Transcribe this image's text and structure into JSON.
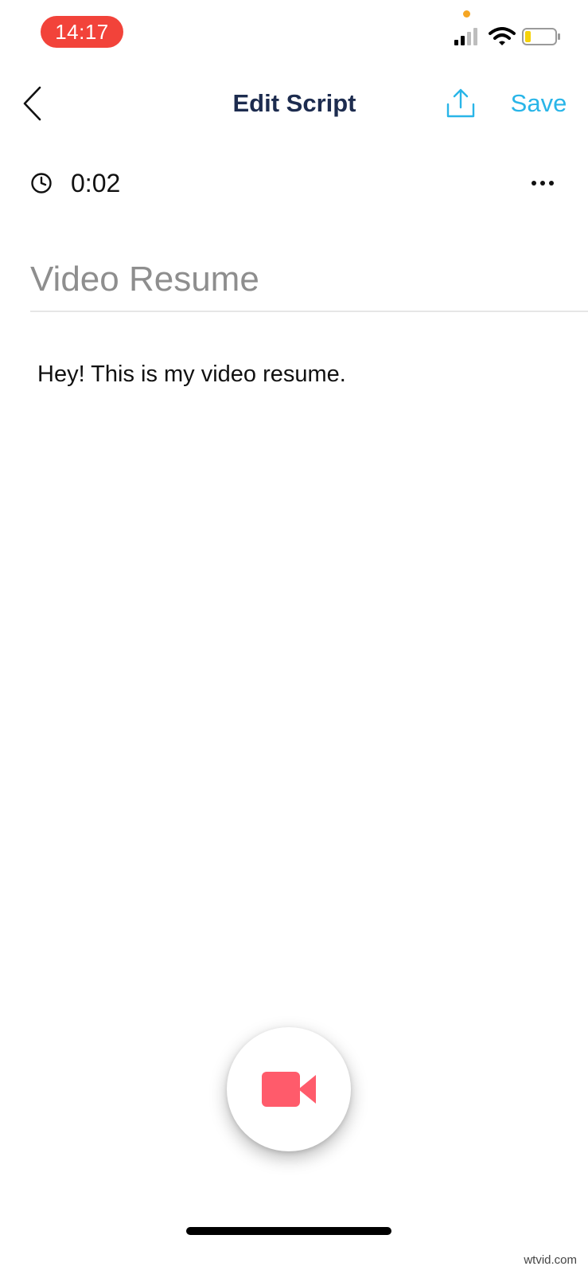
{
  "status_bar": {
    "time": "14:17",
    "time_pill_color": "#f2433a",
    "icons": [
      "signal-icon",
      "wifi-icon",
      "battery-icon"
    ]
  },
  "nav": {
    "back_icon": "chevron-left-icon",
    "title": "Edit Script",
    "share_icon": "share-icon",
    "save_label": "Save",
    "accent_color": "#29b5e8"
  },
  "script": {
    "duration": "0:02",
    "title_placeholder": "Video Resume",
    "body": "Hey! This is my video resume."
  },
  "record": {
    "icon": "video-camera-icon",
    "icon_color": "#ff5b6b"
  },
  "watermark": "wtvid.com"
}
